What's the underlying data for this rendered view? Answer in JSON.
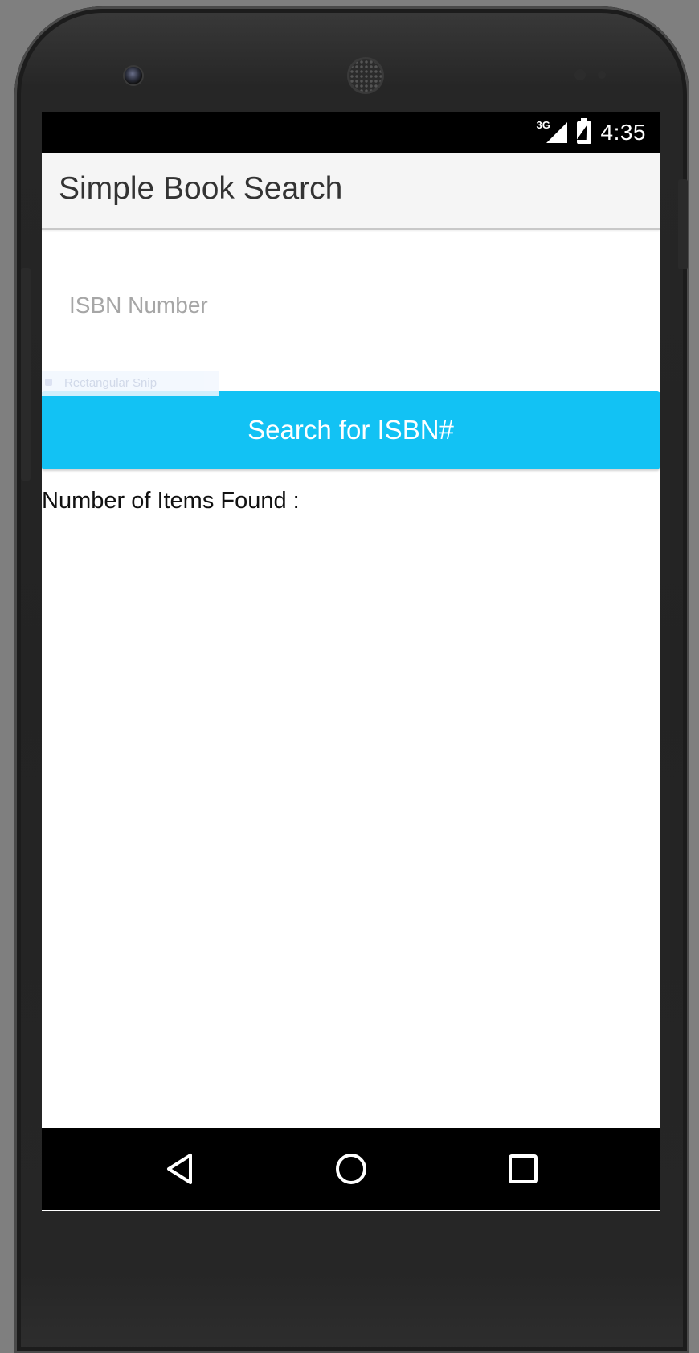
{
  "status_bar": {
    "network_type": "3G",
    "time": "4:35",
    "icons": [
      "signal-icon",
      "battery-charging-icon"
    ]
  },
  "app_bar": {
    "title": "Simple Book Search"
  },
  "form": {
    "isbn_placeholder": "ISBN Number",
    "isbn_value": "",
    "search_button_label": "Search for ISBN#"
  },
  "results": {
    "items_found_label": "Number of Items Found :"
  },
  "overlay": {
    "snip_label": "Rectangular Snip"
  },
  "nav_bar": {
    "icons": [
      "back-icon",
      "home-icon",
      "recent-apps-icon"
    ]
  },
  "colors": {
    "accent": "#12c2f4",
    "app_bar_bg": "#f5f5f5",
    "status_bar_bg": "#000000"
  }
}
